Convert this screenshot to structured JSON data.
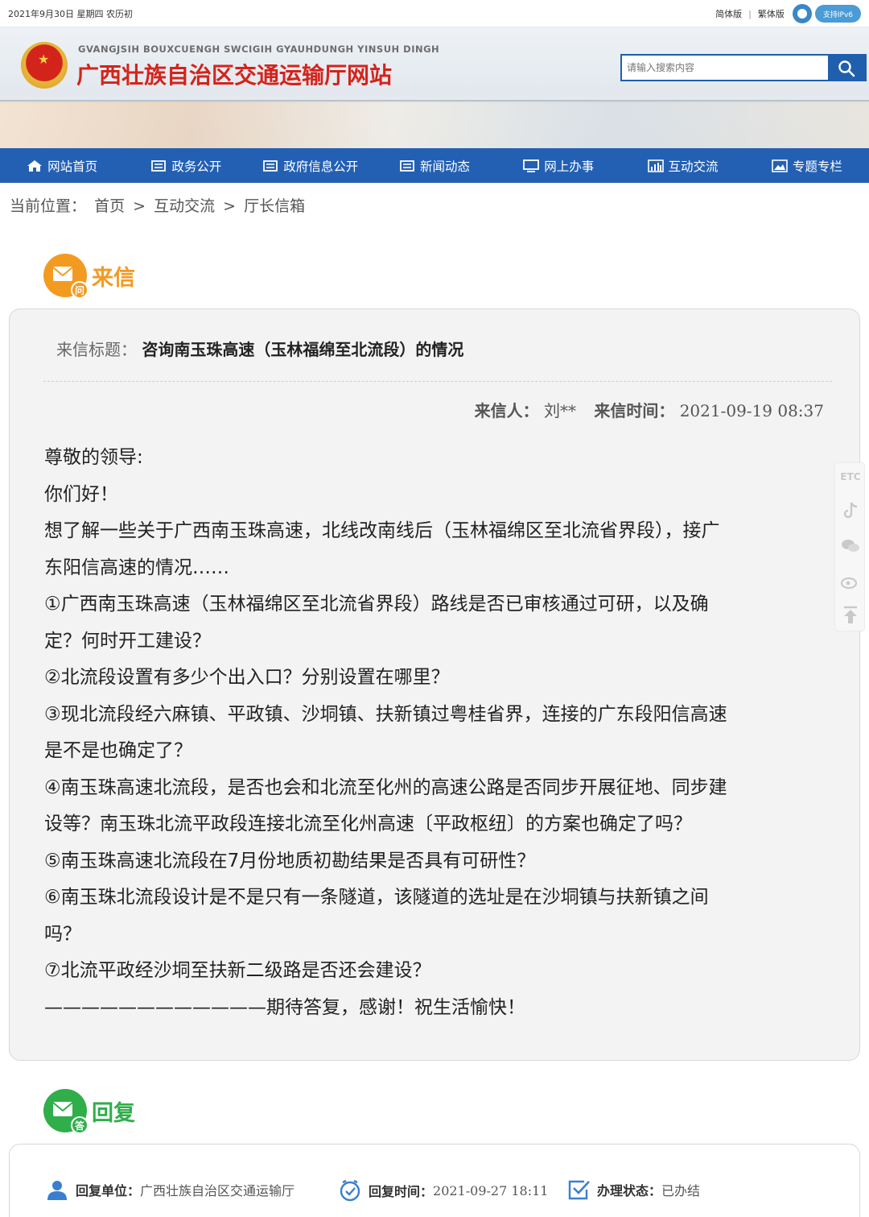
{
  "topbar": {
    "date": "2021年9月30日 星期四 农历初",
    "simplified": "简体版",
    "separator": "|",
    "traditional": "繁体版",
    "ipv6": "支持IPv6"
  },
  "header": {
    "subtitle": "GVANGJSIH BOUXCUENGH SWCIGIH GYAUHDUNGH YINSUH DINGH",
    "title": "广西壮族自治区交通运输厅网站",
    "search_placeholder": "请输入搜索内容"
  },
  "nav": {
    "items": [
      {
        "label": "网站首页",
        "icon": "home-icon"
      },
      {
        "label": "政务公开",
        "icon": "document-icon"
      },
      {
        "label": "政府信息公开",
        "icon": "document-icon"
      },
      {
        "label": "新闻动态",
        "icon": "document-icon"
      },
      {
        "label": "网上办事",
        "icon": "monitor-icon"
      },
      {
        "label": "互动交流",
        "icon": "bar-chart-icon"
      },
      {
        "label": "专题专栏",
        "icon": "image-icon"
      }
    ]
  },
  "breadcrumb": {
    "prefix": "当前位置：",
    "items": [
      "首页",
      "互动交流",
      "厅长信箱"
    ],
    "sep": ">"
  },
  "letter": {
    "heading": "来信",
    "badge_mark": "问",
    "title_label": "来信标题：",
    "title_value": "咨询南玉珠高速（玉林福绵至北流段）的情况",
    "sender_label": "来信人：",
    "sender_value": "刘**",
    "time_label": "来信时间：",
    "time_value": "2021-09-19 08:37",
    "lines": [
      "尊敬的领导:",
      "你们好！",
      "想了解一些关于广西南玉珠高速，北线改南线后（玉林福绵区至北流省界段），接广",
      "东阳信高速的情况……",
      "①广西南玉珠高速（玉林福绵区至北流省界段）路线是否已审核通过可研，以及确",
      "定？何时开工建设？",
      "②北流段设置有多少个出入口？分别设置在哪里？",
      "③现北流段经六麻镇、平政镇、沙垌镇、扶新镇过粤桂省界，连接的广东段阳信高速",
      "是不是也确定了？",
      "④南玉珠高速北流段，是否也会和北流至化州的高速公路是否同步开展征地、同步建",
      "设等？南玉珠北流平政段连接北流至化州高速〔平政枢纽〕的方案也确定了吗？",
      "⑤南玉珠高速北流段在7月份地质初勘结果是否具有可研性？",
      "⑥南玉珠北流段设计是不是只有一条隧道，该隧道的选址是在沙垌镇与扶新镇之间",
      "吗？",
      "⑦北流平政经沙垌至扶新二级路是否还会建设？",
      "————————————期待答复，感谢！祝生活愉快！"
    ]
  },
  "reply": {
    "heading": "回复",
    "badge_mark": "答",
    "unit_label": "回复单位：",
    "unit_value": "广西壮族自治区交通运输厅",
    "time_label": "回复时间：",
    "time_value": "2021-09-27 18:11",
    "status_label": "办理状态：",
    "status_value": "已办结"
  },
  "side_tools": {
    "etc": "ETC"
  },
  "colors": {
    "nav_blue": "#2360b3",
    "title_red": "#d3241b",
    "letter_badge": "#f39a21",
    "reply_badge": "#2fae4a"
  }
}
